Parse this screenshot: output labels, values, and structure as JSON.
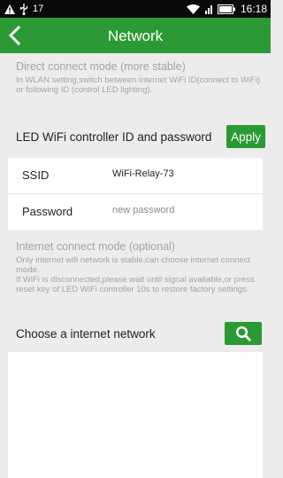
{
  "status_bar": {
    "number": "17",
    "time": "16:18",
    "icons": [
      "alert-icon",
      "usb-icon",
      "wifi-icon",
      "signal-icon",
      "battery-icon"
    ]
  },
  "header": {
    "title": "Network",
    "back_icon": "chevron-left-icon"
  },
  "direct_mode": {
    "title": "Direct connect mode (more stable)",
    "description": "In WLAN setting,switch between internet WiFi ID(connect to WiFi) or following ID (control LED lighting)."
  },
  "controller": {
    "heading": "LED WiFi controller ID and password",
    "apply_label": "Apply",
    "ssid_label": "SSID",
    "ssid_value": "WiFi-Relay-73",
    "password_label": "Password",
    "password_placeholder": "new password"
  },
  "internet_mode": {
    "title": "Internet connect mode (optional)",
    "description_1": "Only internet wifi network is stable,can choose internet connect mode.",
    "description_2": "If WiFi is disconnected,please wait until signal available,or press reset key of LED WiFi controller 10s to restore factory settings."
  },
  "network_choice": {
    "heading": "Choose a internet network",
    "search_icon": "search-icon",
    "networks": []
  },
  "colors": {
    "brand_green": "#2b9a34",
    "status_bar": "#0a0a0a",
    "page_background": "#ececec",
    "hint_text": "#a4a4a4"
  }
}
